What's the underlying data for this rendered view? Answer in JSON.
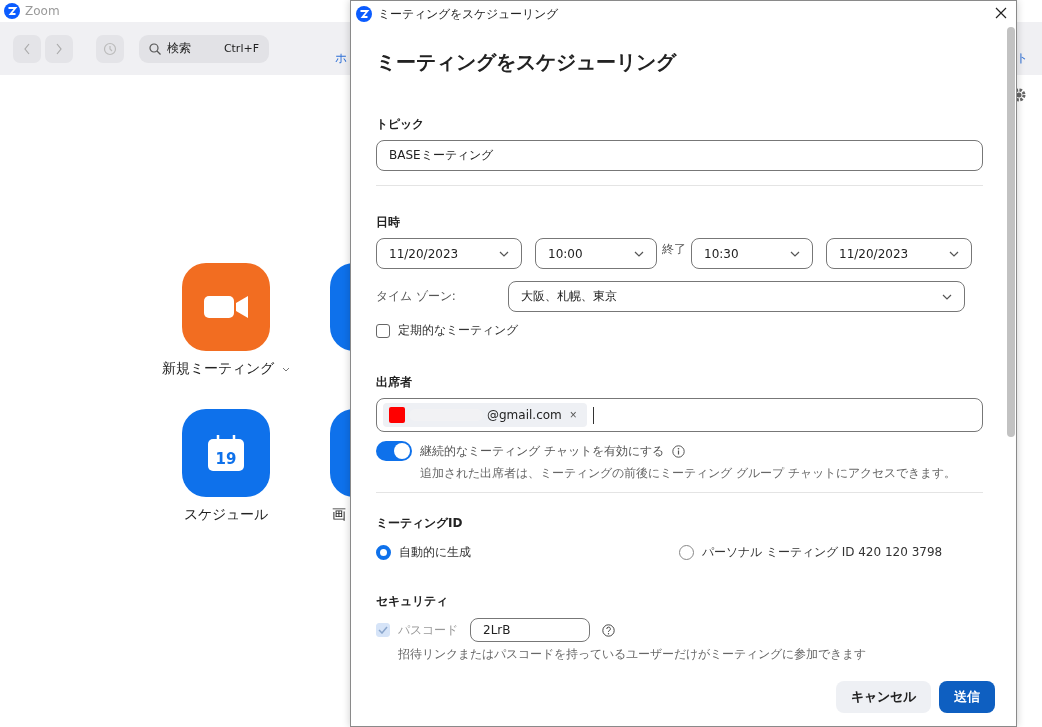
{
  "app": {
    "title": "Zoom",
    "search": {
      "placeholder": "検索",
      "shortcut": "Ctrl+F"
    },
    "tab_left_partial": "ホ",
    "tab_right_partial": "ト",
    "tiles": [
      {
        "kind": "video",
        "label": "新規ミーティング",
        "color": "#f26d21",
        "has_menu": true
      },
      {
        "kind": "blank",
        "color": "#0e71eb"
      },
      {
        "kind": "calendar",
        "label": "スケジュール",
        "date": "19",
        "color": "#0e71eb"
      },
      {
        "kind": "blank",
        "label": "画",
        "color": "#0e71eb"
      }
    ]
  },
  "dialog": {
    "title": "ミーティングをスケジューリング",
    "heading": "ミーティングをスケジューリング",
    "topic": {
      "label": "トピック",
      "value": "BASEミーティング"
    },
    "datetime": {
      "label": "日時",
      "start_date": "11/20/2023",
      "start_time": "10:00",
      "end_label": "終了",
      "end_time": "10:30",
      "end_date": "11/20/2023",
      "timezone_label": "タイム ゾーン:",
      "timezone": "大阪、札幌、東京",
      "recurring": {
        "label": "定期的なミーティング",
        "checked": false
      }
    },
    "attendees": {
      "label": "出席者",
      "chips": [
        {
          "email": "@gmail.com",
          "remove": "×"
        }
      ],
      "chat_toggle": {
        "label": "継続的なミーティング チャットを有効にする",
        "on": true
      },
      "note": "追加された出席者は、ミーティングの前後にミーティング グループ チャットにアクセスできます。"
    },
    "meeting_id": {
      "label": "ミーティングID",
      "options": [
        {
          "label": "自動的に生成",
          "selected": true
        },
        {
          "label": "パーソナル ミーティング ID 420 120 3798",
          "selected": false
        }
      ]
    },
    "security": {
      "label": "セキュリティ",
      "passcode": {
        "label": "パスコード",
        "checked": true,
        "disabled": true,
        "value": "2LrB"
      },
      "note": "招待リンクまたはパスコードを持っているユーザーだけがミーティングに参加できます"
    },
    "buttons": [
      {
        "label": "キャンセル",
        "kind": "secondary"
      },
      {
        "label": "送信",
        "kind": "primary"
      }
    ]
  }
}
